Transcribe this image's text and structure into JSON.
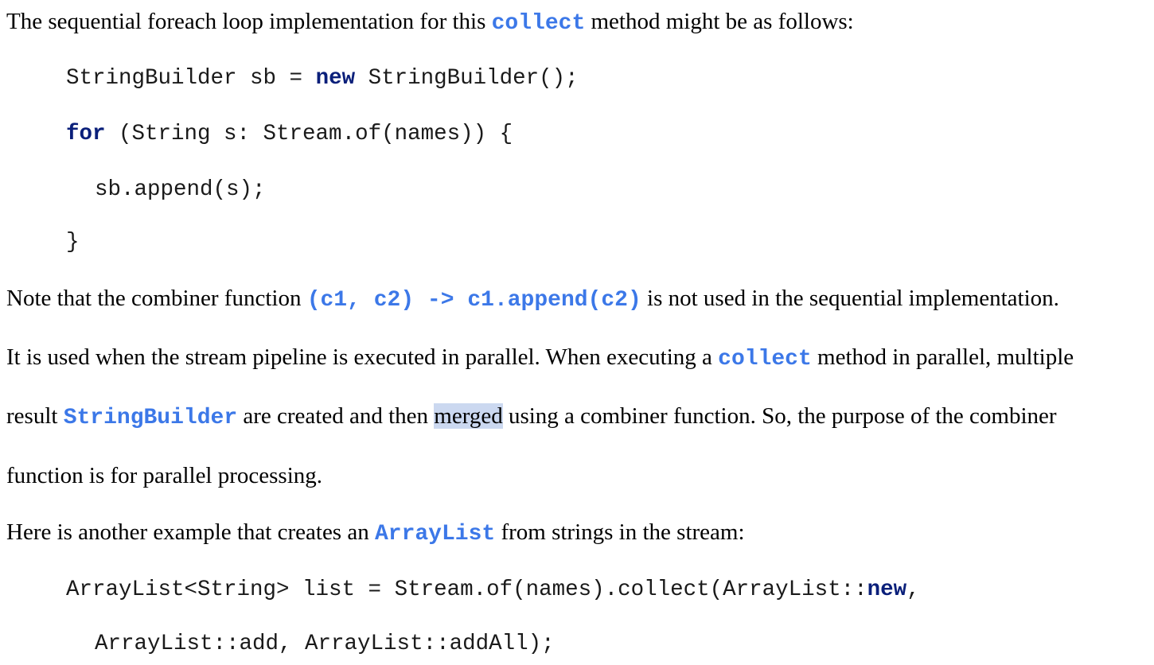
{
  "paragraphs": {
    "p1": {
      "before": "The sequential foreach loop implementation for this ",
      "code": "collect",
      "after": " method might be as follows:"
    },
    "p2": {
      "before": "Note that the combiner function ",
      "code": "(c1, c2) -> c1.append(c2)",
      "after": "  is not used in the sequential implementation."
    },
    "p3": {
      "before": "It is used when the stream pipeline is executed in parallel. When executing a ",
      "code": "collect",
      "after": " method in parallel, multiple"
    },
    "p4": {
      "before": "result ",
      "code": "StringBuilder",
      "middle": " are created and then ",
      "highlight": "merged",
      "after": " using a combiner function. So, the purpose of the combiner"
    },
    "p5": {
      "text": "function is for parallel processing."
    },
    "p6": {
      "before": "Here is another example that creates an ",
      "code": "ArrayList",
      "after": " from strings in the stream:"
    }
  },
  "code1": {
    "line1": {
      "a": "StringBuilder sb = ",
      "kw": "new",
      "b": " StringBuilder();"
    },
    "line2": {
      "kw": "for",
      "b": " (String s: Stream.of(names)) {"
    },
    "line3": {
      "a": "sb.append(s);"
    },
    "line4": {
      "a": "}"
    }
  },
  "code2": {
    "line1": {
      "a": "ArrayList<String> list = Stream.of(names).collect(ArrayList::",
      "kw": "new",
      "b": ","
    },
    "line2": {
      "a": "ArrayList::add, ArrayList::addAll);"
    }
  },
  "colors": {
    "inline_code": "#3c78e8",
    "keyword": "#0a1f7a",
    "selection_highlight": "#cbd8f0"
  }
}
